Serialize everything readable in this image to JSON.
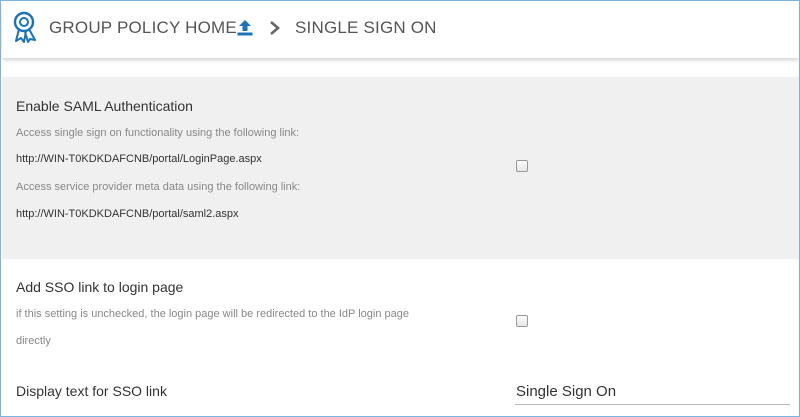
{
  "header": {
    "home_label": "GROUP POLICY HOME",
    "page_label": "SINGLE SIGN ON",
    "logo_icon": "ribbon-badge-icon",
    "upload_icon": "upload-icon",
    "separator_icon": "chevron-right-icon",
    "accent_color": "#1a73b8"
  },
  "saml": {
    "title": "Enable SAML Authentication",
    "sso_desc": "Access single sign on functionality using the following link:",
    "sso_link": "http://WIN-T0KDKDAFCNB/portal/LoginPage.aspx",
    "meta_desc": "Access service provider meta data using the following link:",
    "meta_link": "http://WIN-T0KDKDAFCNB/portal/saml2.aspx",
    "checked": false
  },
  "sso_link_setting": {
    "title": "Add SSO link to login page",
    "desc_line1": "if this setting is unchecked, the login page will be redirected to the IdP login page",
    "desc_line2": "directly",
    "checked": false
  },
  "display_text": {
    "label": "Display text for SSO link",
    "value": "Single Sign On"
  }
}
